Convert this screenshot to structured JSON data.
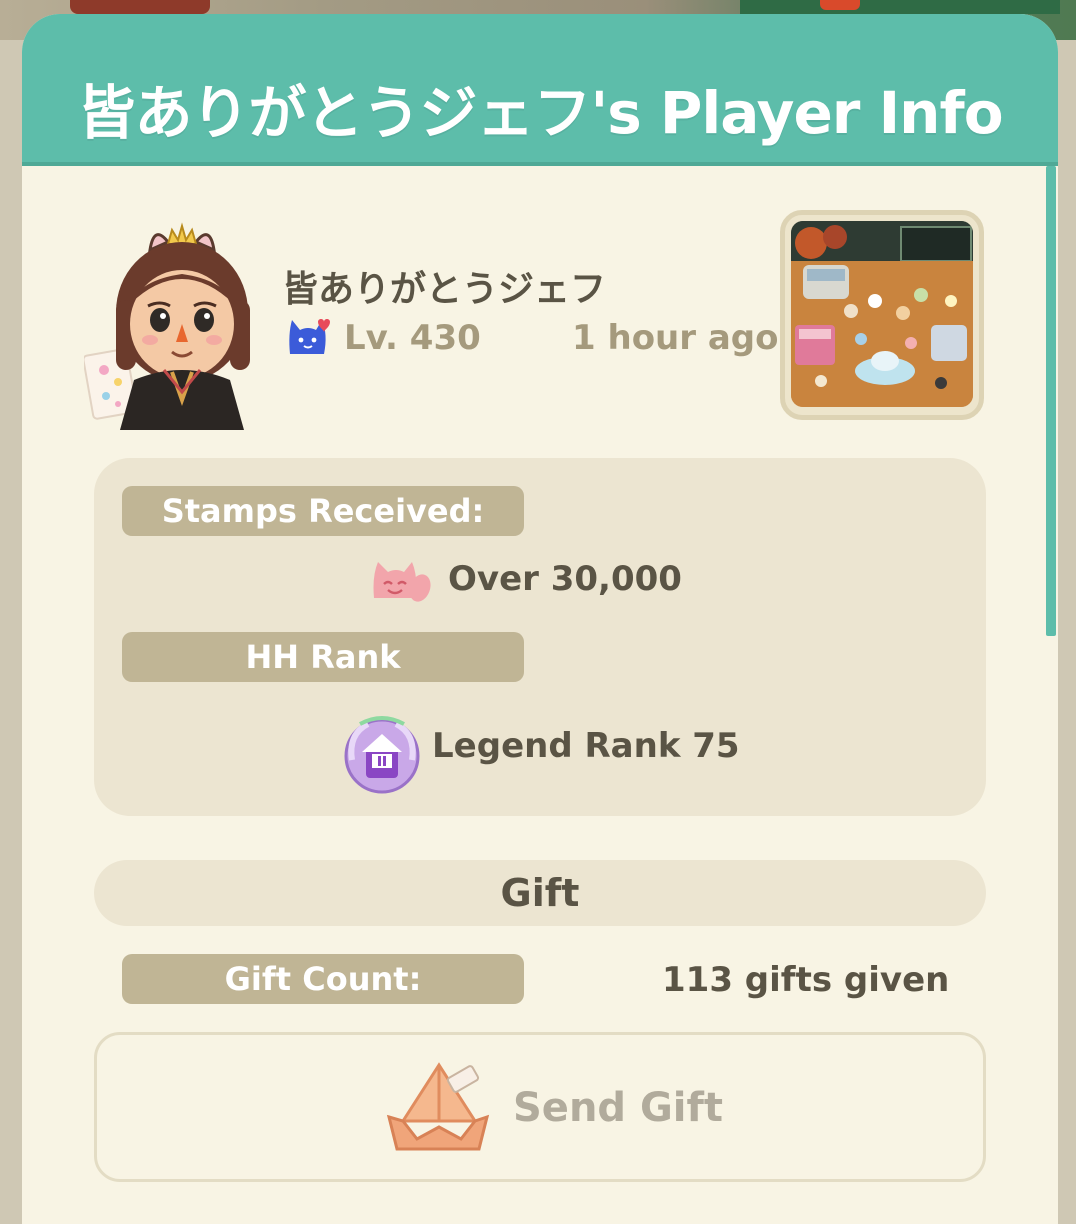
{
  "header": {
    "title": "皆ありがとうジェフ's Player Info"
  },
  "profile": {
    "name": "皆ありがとうジェフ",
    "level": "Lv. 430",
    "last_seen": "1 hour ago",
    "avatar_icon": "player-avatar",
    "friend_icon": "cat-heart-icon"
  },
  "stats": {
    "stamps_label": "Stamps Received:",
    "stamps_value": "Over 30,000",
    "hh_label": "HH Rank",
    "hh_value": "Legend Rank 75"
  },
  "gift": {
    "header": "Gift",
    "count_label": "Gift Count:",
    "count_value": "113 gifts given",
    "send_label": "Send Gift"
  },
  "colors": {
    "header_teal": "#5dbdaa",
    "panel_bg": "#f8f4e4",
    "pill_tan": "#c0b595",
    "text_dark": "#5a5445",
    "text_muted": "#a59a7d"
  }
}
